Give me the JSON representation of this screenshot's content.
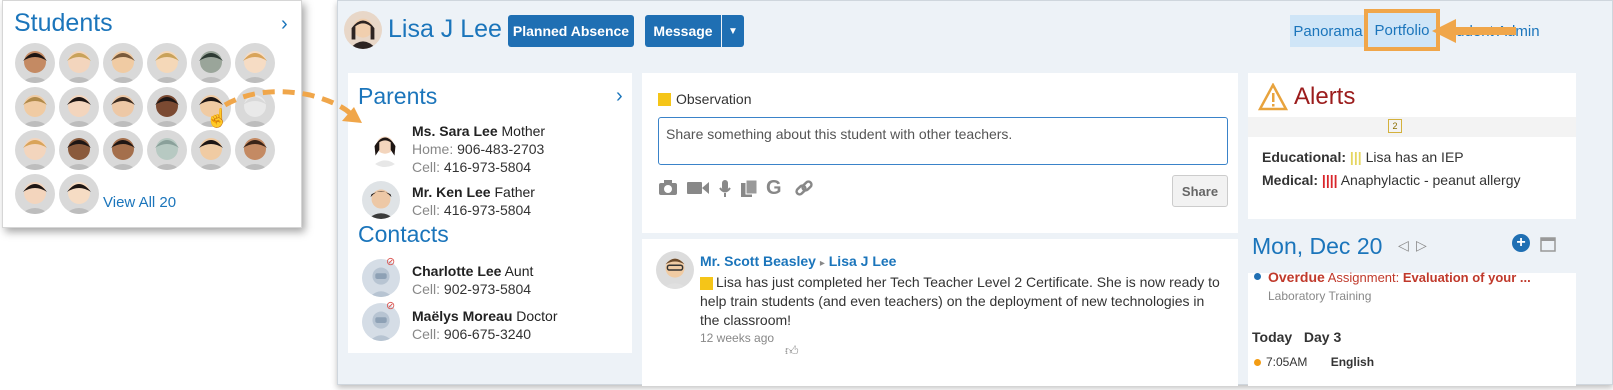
{
  "students": {
    "title": "Students",
    "view_all": "View All 20"
  },
  "header": {
    "student_name": "Lisa J Lee",
    "planned_absence": "Planned Absence",
    "message": "Message",
    "tabs": [
      "Panorama",
      "Portfolio",
      "Student Admin"
    ],
    "admin_visible": "tudent Admin"
  },
  "parents": {
    "title": "Parents",
    "items": [
      {
        "name": "Ms. Sara Lee",
        "relation": "Mother",
        "home_label": "Home:",
        "home": "906-483-2703",
        "cell_label": "Cell:",
        "cell": "416-973-5804"
      },
      {
        "name": "Mr. Ken Lee",
        "relation": "Father",
        "cell_label": "Cell:",
        "cell": "416-973-5804"
      }
    ]
  },
  "contacts": {
    "title": "Contacts",
    "items": [
      {
        "name": "Charlotte Lee",
        "relation": "Aunt",
        "cell_label": "Cell:",
        "cell": "902-973-5804"
      },
      {
        "name": "Maëlys Moreau",
        "relation": "Doctor",
        "cell_label": "Cell:",
        "cell": "906-675-3240"
      }
    ]
  },
  "observation": {
    "label": "Observation",
    "placeholder": "Share something about this student with other teachers.",
    "share": "Share"
  },
  "feed": {
    "author": "Mr. Scott Beasley",
    "target": "Lisa J Lee",
    "body": "Lisa has just completed her Tech Teacher Level 2 Certificate.  She is now ready to help train students (and even teachers) on the deployment of new technologies in the classroom!",
    "time": "12 weeks ago"
  },
  "alerts": {
    "title": "Alerts",
    "calendar_day": "2",
    "educational_label": "Educational:",
    "educational_text": "Lisa has an IEP",
    "medical_label": "Medical:",
    "medical_text": "Anaphylactic - peanut allergy"
  },
  "day": {
    "title": "Mon, Dec 20",
    "overdue": "Overdue",
    "assignment_label": "Assignment:",
    "assignment_text": "Evaluation of your ...",
    "course": "Laboratory Training",
    "today": "Today",
    "day_no": "Day 3",
    "time": "7:05AM",
    "subject": "English"
  },
  "colors": {
    "accent": "#1b75bb",
    "button": "#1f6fb3",
    "highlight": "#f0a64a",
    "alert": "#9b1c1c"
  }
}
